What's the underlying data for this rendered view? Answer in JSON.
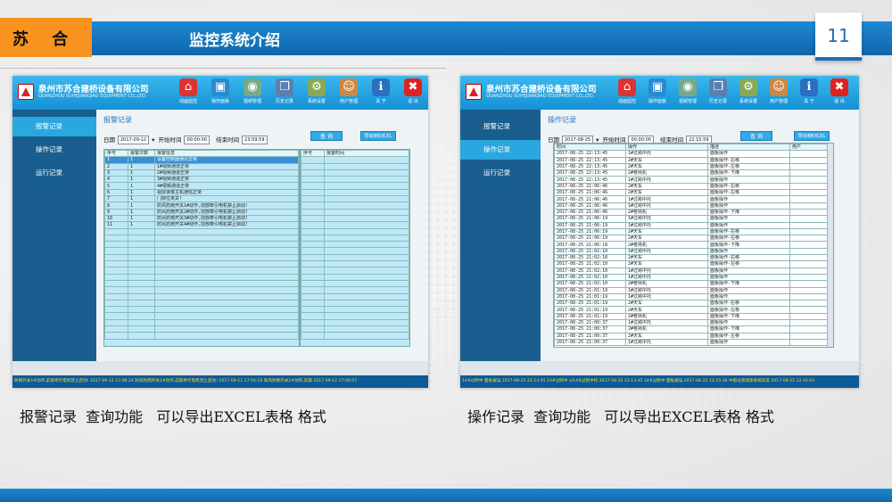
{
  "header": {
    "brand": "苏 合",
    "title": "监控系统介绍",
    "page_number": "11"
  },
  "captions": {
    "left": "报警记录  查询功能   可以导出EXCEL表格 格式",
    "right": "操作记录  查询功能   可以导出EXCEL表格 格式"
  },
  "app": {
    "company_cn": "泉州市苏合建桥设备有限公司",
    "company_en": "QUANZHOU SUHEJIANQIAO EQUIPMENT CO.,LTD.",
    "toolbar": [
      "动画监控",
      "操作面板",
      "视频管理",
      "历史记录",
      "系统设置",
      "用户管理",
      "关 于",
      "退 出"
    ],
    "sidebar": [
      "报警记录",
      "操作记录",
      "运行记录"
    ],
    "query_label": "查 询",
    "export_label": "导出到EXCEL"
  },
  "alarm": {
    "title": "报警记录",
    "date_label": "日期",
    "date_value": "2017-09-12",
    "start_label": "开始时间",
    "start_value": "00:00:00",
    "end_label": "结束时间",
    "end_value": "23:59:59",
    "columns": [
      "序号",
      "报警次数",
      "报警信息"
    ],
    "columns2": [
      "序号",
      "报警时间"
    ],
    "rows": [
      [
        "1",
        "1",
        "设备控制器通讯异常"
      ],
      [
        "2",
        "1",
        "1#视频通道正常"
      ],
      [
        "3",
        "1",
        "2#视频通道正常"
      ],
      [
        "4",
        "1",
        "3#视频通道正常"
      ],
      [
        "5",
        "1",
        "4#视频通道正常"
      ],
      [
        "6",
        "1",
        "视屏录像主机通信正常"
      ],
      [
        "7",
        "1",
        "门限位未关!"
      ],
      [
        "8",
        "1",
        "防风防雨开关1#动作,前部牵引电机禁止启动!"
      ],
      [
        "9",
        "1",
        "防风防雨开关2#动作,前部牵引电机禁止启动!"
      ],
      [
        "10",
        "1",
        "防风防雨开关3#动作,前部牵引电机禁止启动!"
      ],
      [
        "11",
        "1",
        "防风防雨开关4#动作,前部牵引电机禁止启动!"
      ]
    ],
    "status": "防雨开关1#动作,前部牵引电机禁止启动!    2017-09-12 17:06:24 防风防雨开关1#动作,前部牵引电机禁止启动!    2017-09-12 17:06:24 防风防雨开关1#动作,前部    2017-09-12 17:06:57"
  },
  "ops": {
    "title": "操作记录",
    "date_label": "日期",
    "date_value": "2017-08-25",
    "start_label": "开始时间",
    "start_value": "00:00:00",
    "end_label": "结束时间",
    "end_value": "22:15:59",
    "columns": [
      "时间",
      "操作",
      "描述",
      "用户"
    ],
    "rows": [
      [
        "2017-08-25 22:13:45",
        "1#过跨中托",
        "面板操作"
      ],
      [
        "2017-08-25 22:13:45",
        "2#天车",
        "面板操作-右移"
      ],
      [
        "2017-08-25 22:13:45",
        "2#天车",
        "面板操作-左移"
      ],
      [
        "2017-08-25 22:13:45",
        "2#卷扬机",
        "面板操作-下降"
      ],
      [
        "2017-08-25 22:13:45",
        "1#过跨中托",
        "面板操作"
      ],
      [
        "2017-08-25 21:06:46",
        "2#天车",
        "面板操作-右移"
      ],
      [
        "2017-08-25 21:06:46",
        "2#天车",
        "面板操作-左移"
      ],
      [
        "2017-08-25 21:06:46",
        "1#过跨中托",
        "面板操作"
      ],
      [
        "2017-08-25 21:06:46",
        "1#过跨中托",
        "面板操作"
      ],
      [
        "2017-08-25 21:06:46",
        "2#卷扬机",
        "面板操作-下降"
      ],
      [
        "2017-08-25 21:06:19",
        "1#过跨中托",
        "面板操作"
      ],
      [
        "2017-08-25 21:06:19",
        "1#过跨中托",
        "面板操作"
      ],
      [
        "2017-08-25 21:06:19",
        "2#天车",
        "面板操作-右移"
      ],
      [
        "2017-08-25 21:06:19",
        "2#天车",
        "面板操作-左移"
      ],
      [
        "2017-08-25 21:06:18",
        "2#卷扬机",
        "面板操作-下降"
      ],
      [
        "2017-08-25 21:02:10",
        "1#过跨中托",
        "面板操作"
      ],
      [
        "2017-08-25 21:02:10",
        "2#天车",
        "面板操作-右移"
      ],
      [
        "2017-08-25 21:02:10",
        "2#天车",
        "面板操作-左移"
      ],
      [
        "2017-08-25 21:02:10",
        "1#过跨中托",
        "面板操作"
      ],
      [
        "2017-08-25 21:02:10",
        "1#过跨中托",
        "面板操作"
      ],
      [
        "2017-08-25 21:02:10",
        "2#卷扬机",
        "面板操作-下降"
      ],
      [
        "2017-08-25 21:01:19",
        "1#过跨中托",
        "面板操作"
      ],
      [
        "2017-08-25 21:01:19",
        "1#过跨中托",
        "面板操作"
      ],
      [
        "2017-08-25 21:01:19",
        "2#天车",
        "面板操作-右移"
      ],
      [
        "2017-08-25 21:01:19",
        "2#天车",
        "面板操作-左移"
      ],
      [
        "2017-08-25 21:01:19",
        "2#卷扬机",
        "面板操作-下降"
      ],
      [
        "2017-08-25 21:00:37",
        "1#过跨中托",
        "面板操作"
      ],
      [
        "2017-08-25 21:00:37",
        "2#卷扬机",
        "面板操作-下降"
      ],
      [
        "2017-08-25 21:00:37",
        "2#天车",
        "面板操作-左移"
      ],
      [
        "2017-08-25 21:00:37",
        "1#过跨中托",
        "面板操作"
      ]
    ],
    "status": "14#过跨中 面板被误    2017-08-25 22:13:45 14#过跨中 x/14#过跨中托    2017-08-25 22:13:45 14#过跨中 面板被误    2017-08-25 22:15:36 中部过渡测速系统异常    2017-08-25 22:16:03"
  },
  "colors": {
    "accent": "#1a78c2",
    "orange": "#f7931e",
    "sidebar": "#1a5e8f",
    "grid": "#bfe8f7"
  }
}
